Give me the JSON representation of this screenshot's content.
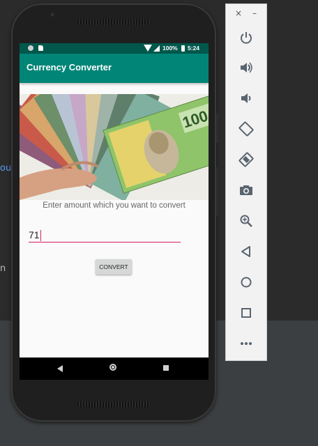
{
  "ide": {
    "left_text_blue": "ou",
    "left_text_gray": "n"
  },
  "device": {
    "status_bar": {
      "battery_percent": "100%",
      "time": "5:24"
    },
    "app": {
      "title": "Currency Converter",
      "hint": "Enter amount which you want to convert",
      "amount_value": "71",
      "convert_label": "CONVERT"
    },
    "nav_bar": {
      "icons": [
        "back-icon",
        "home-icon",
        "recents-icon"
      ]
    }
  },
  "emulator_toolbar": {
    "close_symbol": "×",
    "minimize_symbol": "–",
    "buttons": [
      "power-icon",
      "volume-up-icon",
      "volume-down-icon",
      "rotate-left-icon",
      "rotate-right-icon",
      "camera-icon",
      "zoom-icon",
      "back-icon",
      "home-icon",
      "overview-icon",
      "more-icon"
    ]
  },
  "colors": {
    "app_bar": "#008577",
    "status_bar": "#00574b",
    "accent": "#d81b60"
  }
}
